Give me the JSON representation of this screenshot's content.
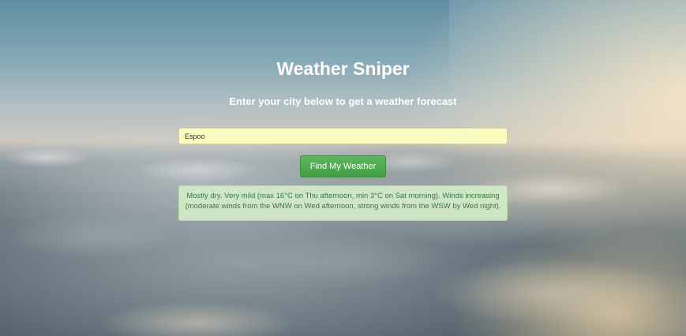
{
  "page": {
    "title": "Weather Sniper",
    "subtitle": "Enter your city below to get a weather forecast"
  },
  "form": {
    "city_value": "Espoo",
    "submit_label": "Find My Weather"
  },
  "forecast": {
    "text": "Mostly dry. Very mild (max 16°C on Thu afternoon, min 3°C on Sat morning). Winds increasing (moderate winds from the WNW on Wed afternoon, strong winds from the WSW by Wed night)."
  },
  "colors": {
    "button": "#5cb85c",
    "input_background": "#fbfdc0",
    "forecast_background": "#d2ecc8",
    "forecast_text": "#3c763d"
  }
}
